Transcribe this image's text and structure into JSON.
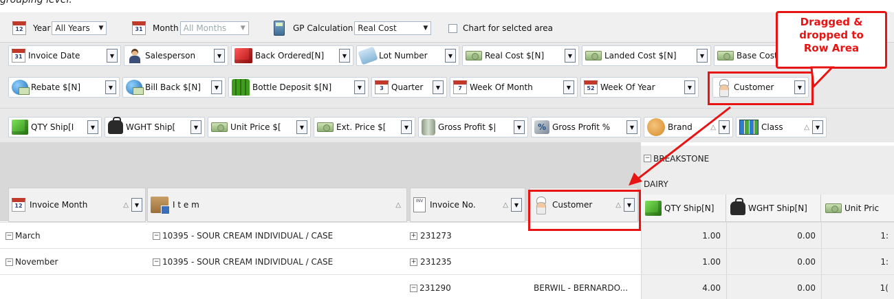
{
  "caption": "grouping level.",
  "top_bar": {
    "year_label": "Year",
    "year_value": "All Years",
    "month_label": "Month",
    "month_value": "All Months",
    "gp_label": "GP Calculation",
    "gp_value": "Real Cost",
    "chart_checkbox_label": "Chart for selcted area",
    "year_icon_text": "12",
    "month_icon_text": "31"
  },
  "filter_fields_row1": [
    {
      "label": "Invoice Date",
      "icon": "calendar-icon",
      "icon_text": "31"
    },
    {
      "label": "Salesperson",
      "icon": "person-icon"
    },
    {
      "label": "Back Ordered[N]",
      "icon": "red-cubes-icon"
    },
    {
      "label": "Lot Number",
      "icon": "tag-icon"
    },
    {
      "label": "Real Cost $[N]",
      "icon": "money-icon"
    },
    {
      "label": "Landed Cost $[N]",
      "icon": "money-icon"
    },
    {
      "label": "Base Cost",
      "icon": "money-icon"
    }
  ],
  "filter_fields_row2": [
    {
      "label": "Rebate $[N]",
      "icon": "globe-money-icon"
    },
    {
      "label": "Bill Back $[N]",
      "icon": "globe-money-icon"
    },
    {
      "label": "Bottle Deposit $[N]",
      "icon": "bottles-icon"
    },
    {
      "label": "Quarter",
      "icon": "calendar-icon",
      "icon_text": "3"
    },
    {
      "label": "Week Of Month",
      "icon": "calendar-icon",
      "icon_text": "7"
    },
    {
      "label": "Week Of Year",
      "icon": "calendar-icon",
      "icon_text": "52"
    },
    {
      "label": "Customer",
      "icon": "chef-icon"
    }
  ],
  "data_fields": [
    {
      "label": "QTY Ship[I",
      "icon": "green-cubes-icon"
    },
    {
      "label": "WGHT Ship[",
      "icon": "weight-icon"
    },
    {
      "label": "Unit Price $[",
      "icon": "money-icon"
    },
    {
      "label": "Ext. Price $[",
      "icon": "money-icon"
    },
    {
      "label": "Gross Profit $|",
      "icon": "jar-icon"
    },
    {
      "label": "Gross Profit %",
      "icon": "percent-icon"
    },
    {
      "label": "Brand",
      "icon": "brand-icon",
      "sort": "△"
    },
    {
      "label": "Class",
      "icon": "binders-icon",
      "sort": "△"
    }
  ],
  "column_headers": {
    "level1": "BREAKSTONE",
    "level2": "DAIRY"
  },
  "row_fields": [
    {
      "label": "Invoice Month",
      "icon": "calendar-icon",
      "icon_text": "12",
      "sort": "△"
    },
    {
      "label": "I t e m",
      "icon": "box-icon",
      "sort": "△"
    },
    {
      "label": "Invoice No.",
      "icon": "invoice-icon",
      "icon_text": "INV",
      "sort": "△"
    },
    {
      "label": "Customer",
      "icon": "chef-icon",
      "sort": "△"
    }
  ],
  "measure_headers": [
    {
      "label": "QTY Ship[N]",
      "icon": "green-cubes-icon"
    },
    {
      "label": "WGHT Ship[N]",
      "icon": "weight-icon"
    },
    {
      "label": "Unit Pric",
      "icon": "money-icon"
    }
  ],
  "rows": [
    {
      "month": "March",
      "item": "10395 - SOUR CREAM INDIVIDUAL / CASE",
      "invoice": "231273",
      "customer": "",
      "qty": "1.00",
      "wght": "0.00",
      "unit": "1:"
    },
    {
      "month": "November",
      "item": "10395 - SOUR CREAM INDIVIDUAL / CASE",
      "invoice": "231235",
      "customer": "",
      "qty": "1.00",
      "wght": "0.00",
      "unit": "1:"
    },
    {
      "month": "",
      "item": "",
      "invoice": "231290",
      "customer": "BERWIL - BERNARDO...",
      "qty": "4.00",
      "wght": "0.00",
      "unit": "1("
    }
  ],
  "callout": {
    "line1": "Dragged &",
    "line2": "dropped to",
    "line3": "Row Area"
  },
  "colors": {
    "annotation": "#e81414"
  }
}
